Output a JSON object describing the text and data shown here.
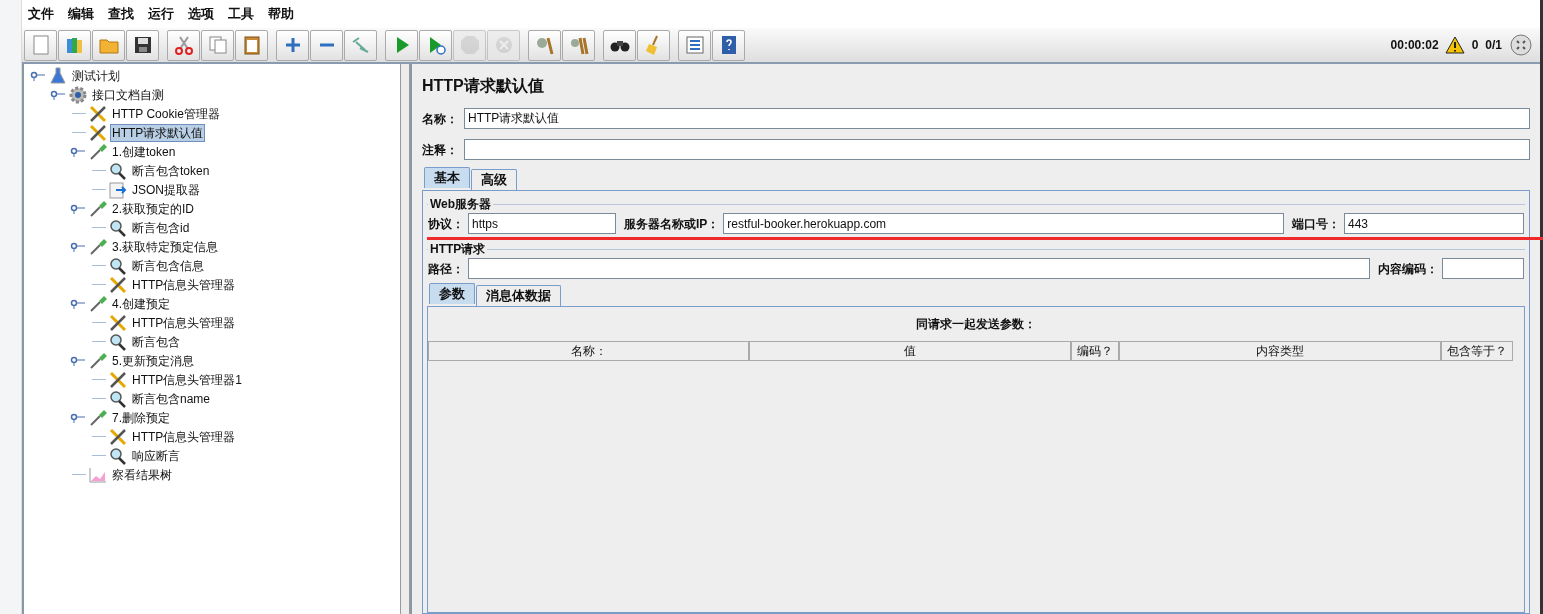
{
  "menu": [
    "文件",
    "编辑",
    "查找",
    "运行",
    "选项",
    "工具",
    "帮助"
  ],
  "toolbar": [
    [
      {
        "kind": "new",
        "disabled": false
      },
      {
        "kind": "templates",
        "disabled": false
      },
      {
        "kind": "open",
        "disabled": false
      },
      {
        "kind": "save",
        "disabled": false
      }
    ],
    [
      {
        "kind": "cut",
        "disabled": false
      },
      {
        "kind": "copy",
        "disabled": false
      },
      {
        "kind": "paste",
        "disabled": false
      }
    ],
    [
      {
        "kind": "expand",
        "disabled": false
      },
      {
        "kind": "collapse",
        "disabled": false
      },
      {
        "kind": "toggle",
        "disabled": false
      }
    ],
    [
      {
        "kind": "start",
        "disabled": false
      },
      {
        "kind": "start-no-pause",
        "disabled": false
      },
      {
        "kind": "stop",
        "disabled": true
      },
      {
        "kind": "shutdown",
        "disabled": true
      }
    ],
    [
      {
        "kind": "clear",
        "disabled": false
      },
      {
        "kind": "clear-all",
        "disabled": false
      }
    ],
    [
      {
        "kind": "search",
        "disabled": false
      },
      {
        "kind": "reset-search",
        "disabled": false
      }
    ],
    [
      {
        "kind": "function",
        "disabled": false
      },
      {
        "kind": "help",
        "disabled": false
      }
    ]
  ],
  "status": {
    "timer": "00:00:02",
    "warnings": "0",
    "threads": "0/1"
  },
  "tree": [
    {
      "label": "测试计划",
      "kind": "plan",
      "selected": false,
      "children": [
        {
          "label": "接口文档自测",
          "kind": "group",
          "selected": false,
          "children": [
            {
              "label": "HTTP Cookie管理器",
              "kind": "config",
              "selected": false
            },
            {
              "label": "HTTP请求默认值",
              "kind": "config",
              "selected": true
            },
            {
              "label": "1.创建token",
              "kind": "sampler",
              "selected": false,
              "children": [
                {
                  "label": "断言包含token",
                  "kind": "assertion",
                  "selected": false
                },
                {
                  "label": "JSON提取器",
                  "kind": "extractor",
                  "selected": false
                }
              ]
            },
            {
              "label": "2.获取预定的ID",
              "kind": "sampler",
              "selected": false,
              "children": [
                {
                  "label": "断言包含id",
                  "kind": "assertion",
                  "selected": false
                }
              ]
            },
            {
              "label": "3.获取特定预定信息",
              "kind": "sampler",
              "selected": false,
              "children": [
                {
                  "label": "断言包含信息",
                  "kind": "assertion",
                  "selected": false
                },
                {
                  "label": "HTTP信息头管理器",
                  "kind": "config",
                  "selected": false
                }
              ]
            },
            {
              "label": "4.创建预定",
              "kind": "sampler",
              "selected": false,
              "children": [
                {
                  "label": "HTTP信息头管理器",
                  "kind": "config",
                  "selected": false
                },
                {
                  "label": "断言包含",
                  "kind": "assertion",
                  "selected": false
                }
              ]
            },
            {
              "label": "5.更新预定消息",
              "kind": "sampler",
              "selected": false,
              "children": [
                {
                  "label": "HTTP信息头管理器1",
                  "kind": "config",
                  "selected": false
                },
                {
                  "label": "断言包含name",
                  "kind": "assertion",
                  "selected": false
                }
              ]
            },
            {
              "label": "7.删除预定",
              "kind": "sampler",
              "selected": false,
              "children": [
                {
                  "label": "HTTP信息头管理器",
                  "kind": "config",
                  "selected": false
                },
                {
                  "label": "响应断言",
                  "kind": "assertion",
                  "selected": false
                }
              ]
            },
            {
              "label": "察看结果树",
              "kind": "listener",
              "selected": false
            }
          ]
        }
      ]
    }
  ],
  "panel": {
    "title": "HTTP请求默认值",
    "name": {
      "label": "名称：",
      "value": "HTTP请求默认值"
    },
    "comment": {
      "label": "注释："
    },
    "tabs": [
      {
        "label": "基本",
        "selected": true
      },
      {
        "label": "高级",
        "selected": false
      }
    ],
    "web_server": {
      "legend": "Web服务器",
      "protocol": {
        "label": "协议：",
        "value": "https"
      },
      "server": {
        "label": "服务器名称或IP：",
        "value": "restful-booker.herokuapp.com"
      },
      "port": {
        "label": "端口号：",
        "value": "443"
      },
      "highlighted": true
    },
    "http_request": {
      "legend": "HTTP请求",
      "path": {
        "label": "路径："
      },
      "encoding": {
        "label": "内容编码："
      }
    },
    "inner_tabs": [
      {
        "label": "参数",
        "selected": true
      },
      {
        "label": "消息体数据",
        "selected": false
      }
    ],
    "table": {
      "caption": "同请求一起发送参数：",
      "columns": [
        "名称：",
        "值",
        "编码？",
        "内容类型",
        "包含等于？"
      ]
    }
  }
}
